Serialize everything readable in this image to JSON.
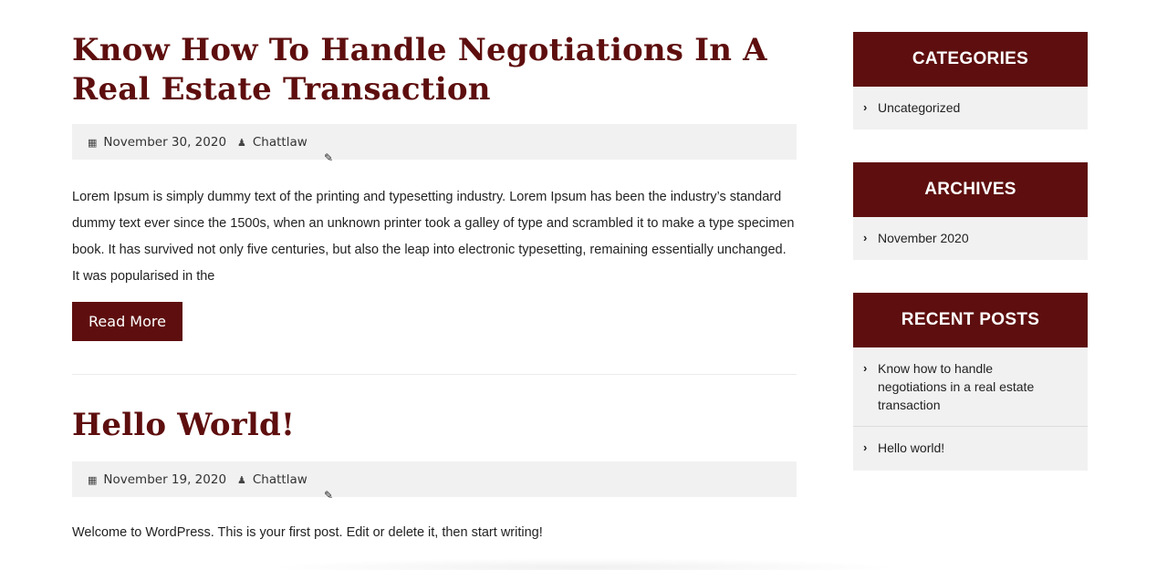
{
  "posts": [
    {
      "title": "Know How To Handle Negotiations In A Real Estate Transaction",
      "date": "November 30, 2020",
      "author": "Chattlaw",
      "excerpt": "Lorem Ipsum is simply dummy text of the printing and typesetting industry. Lorem Ipsum has been the industry’s standard dummy text ever since the 1500s, when an unknown printer took a galley of type and scrambled it to make a type specimen book. It has survived not only five centuries, but also the leap into electronic typesetting, remaining essentially unchanged. It was popularised in the",
      "read_more": "Read More"
    },
    {
      "title": "Hello World!",
      "date": "November 19, 2020",
      "author": "Chattlaw",
      "excerpt": "Welcome to WordPress. This is your first post. Edit or delete it, then start writing!"
    }
  ],
  "sidebar": {
    "categories": {
      "title": "CATEGORIES",
      "items": [
        "Uncategorized"
      ]
    },
    "archives": {
      "title": "ARCHIVES",
      "items": [
        "November 2020"
      ]
    },
    "recent_posts": {
      "title": "RECENT POSTS",
      "items": [
        "Know how to handle negotiations in a real estate transaction",
        "Hello world!"
      ]
    }
  },
  "icons": {
    "calendar": "calendar-icon",
    "user": "user-icon",
    "edit": "pencil-icon",
    "chevron": "chevron-right-icon"
  },
  "colors": {
    "accent": "#5e0e0e",
    "meta_bg": "#f1f1f1",
    "widget_bg": "#f1f1f1"
  }
}
